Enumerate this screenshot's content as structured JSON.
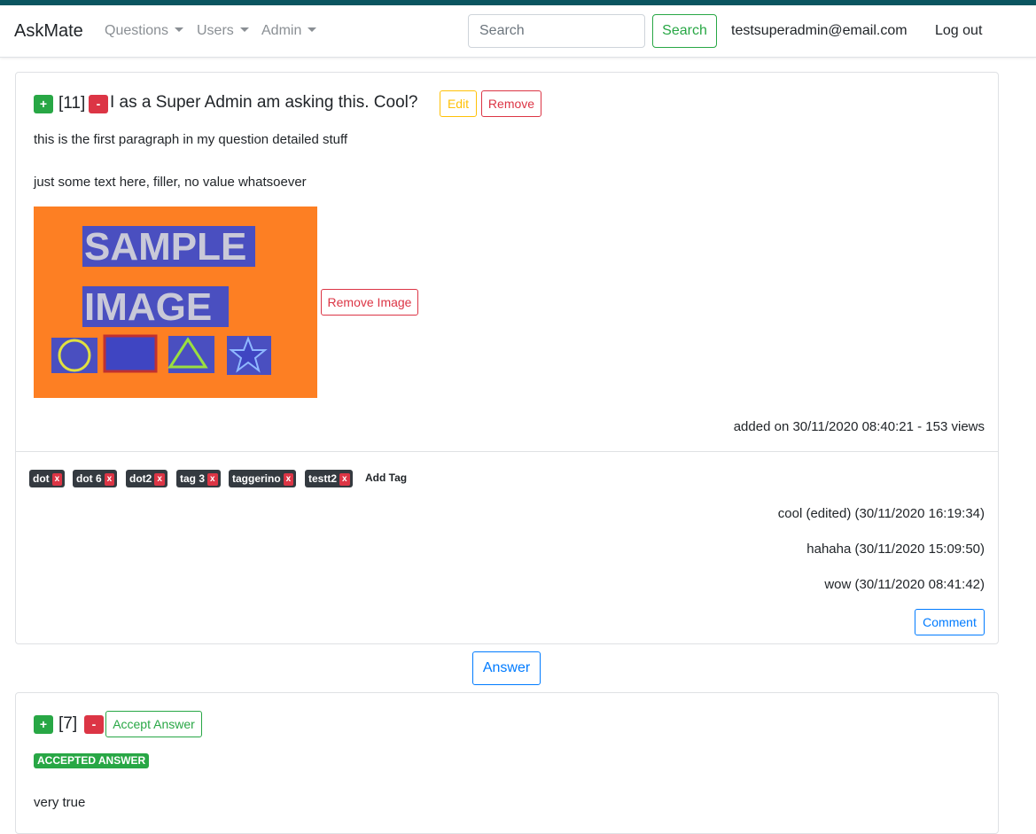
{
  "nav": {
    "brand": "AskMate",
    "questions": "Questions",
    "users": "Users",
    "admin": "Admin",
    "search_placeholder": "Search",
    "search_button": "Search",
    "user_email": "testsuperadmin@email.com",
    "logout": "Log out"
  },
  "question": {
    "upvote": "+",
    "score": "[11]",
    "downvote": "-",
    "title": "I as a Super Admin am asking this. Cool?",
    "edit": "Edit",
    "remove": "Remove",
    "paragraph1": "this is the first paragraph in my question detailed stuff",
    "paragraph2": "just some text here, filler, no value whatsoever",
    "image": {
      "line1": "SAMPLE",
      "line2": "IMAGE",
      "bg_color": "#fd7f23",
      "text_color": "#4a4fc0"
    },
    "remove_image": "Remove Image",
    "meta": "added on 30/11/2020 08:40:21 - 153 views",
    "tags": [
      {
        "label": "dot",
        "remove": "x"
      },
      {
        "label": "dot 6",
        "remove": "x"
      },
      {
        "label": "dot2",
        "remove": "x"
      },
      {
        "label": "tag 3",
        "remove": "x"
      },
      {
        "label": "taggerino",
        "remove": "x"
      },
      {
        "label": "testt2",
        "remove": "x"
      }
    ],
    "add_tag": "Add Tag",
    "comments": [
      "cool (edited) (30/11/2020 16:19:34)",
      "hahaha (30/11/2020 15:09:50)",
      "wow (30/11/2020 08:41:42)"
    ],
    "comment_button": "Comment"
  },
  "answer_button": "Answer",
  "answer": {
    "upvote": "+",
    "score": "[7]",
    "downvote": "-",
    "accept": "Accept Answer",
    "accepted_badge": "ACCEPTED ANSWER",
    "text": "very true"
  },
  "colors": {
    "topbar": "#0b5560",
    "success": "#28a745",
    "danger": "#dc3545",
    "warning": "#ffc107",
    "primary": "#007bff",
    "tag_bg": "#343a40"
  }
}
